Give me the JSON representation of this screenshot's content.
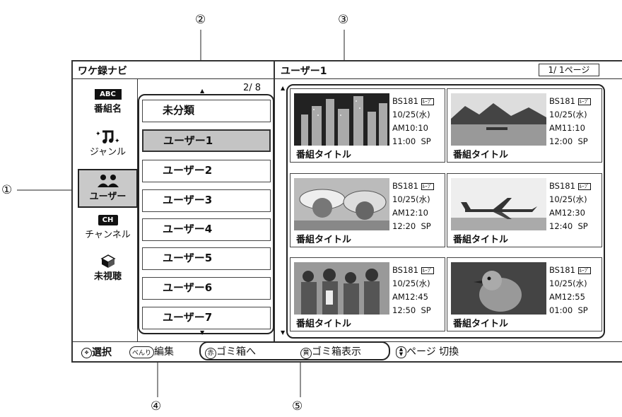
{
  "callouts": [
    "①",
    "②",
    "③",
    "④",
    "⑤"
  ],
  "header": {
    "left_title": "ワケ録ナビ",
    "right_title": "ユーザー1",
    "page": "1/ 1ページ"
  },
  "sidebar": [
    {
      "badge": "ABC",
      "label": "番組名",
      "icon": "abc-badge-icon"
    },
    {
      "label": "ジャンル",
      "icon": "music-genre-icon"
    },
    {
      "label": "ユーザー",
      "icon": "users-icon",
      "selected": true
    },
    {
      "badge": "CH",
      "label": "チャンネル",
      "icon": "ch-badge-icon"
    },
    {
      "label": "未視聴",
      "icon": "unwatched-box-icon"
    }
  ],
  "folders": {
    "count": "2/ 8",
    "items": [
      "未分類",
      "ユーザー1",
      "ユーザー2",
      "ユーザー3",
      "ユーザー4",
      "ユーザー5",
      "ユーザー6",
      "ユーザー7"
    ],
    "selected_index": 1
  },
  "recordings": [
    {
      "channel": "BS181",
      "date": "10/25(水)",
      "start": "AM10:10",
      "end": "11:00",
      "mode": "SP",
      "title": "番組タイトル",
      "thumb": "city-skyline"
    },
    {
      "channel": "BS181",
      "date": "10/25(水)",
      "start": "AM11:10",
      "end": "12:00",
      "mode": "SP",
      "title": "番組タイトル",
      "thumb": "mountain-lake"
    },
    {
      "channel": "BS181",
      "date": "10/25(水)",
      "start": "AM12:10",
      "end": "12:20",
      "mode": "SP",
      "title": "番組タイトル",
      "thumb": "people-hats"
    },
    {
      "channel": "BS181",
      "date": "10/25(水)",
      "start": "AM12:30",
      "end": "12:40",
      "mode": "SP",
      "title": "番組タイトル",
      "thumb": "airplane"
    },
    {
      "channel": "BS181",
      "date": "10/25(水)",
      "start": "AM12:45",
      "end": "12:50",
      "mode": "SP",
      "title": "番組タイトル",
      "thumb": "crowd"
    },
    {
      "channel": "BS181",
      "date": "10/25(水)",
      "start": "AM12:55",
      "end": "01:00",
      "mode": "SP",
      "title": "番組タイトル",
      "thumb": "bird"
    }
  ],
  "footer": {
    "select": "選択",
    "benri_key": "べんり",
    "edit": "編集",
    "red_key": "赤",
    "trash": "ゴミ箱へ",
    "yellow_key": "黄",
    "trash_show": "ゴミ箱表示",
    "page_switch": "ページ 切換"
  },
  "colors": {
    "selected_bg": "#c4c4c4",
    "frame": "#333333"
  }
}
